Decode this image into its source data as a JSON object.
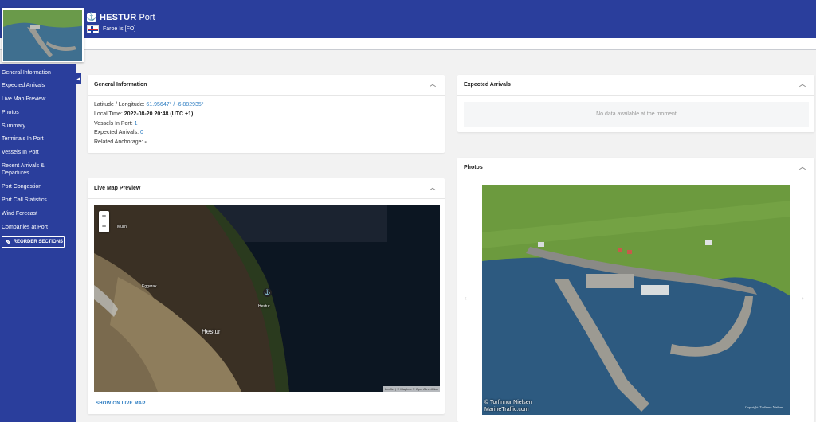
{
  "header": {
    "port_name": "HESTUR",
    "port_type": "Port",
    "country": "Faroe Is [FO]"
  },
  "sidebar": {
    "items": [
      {
        "label": "General Information"
      },
      {
        "label": "Expected Arrivals"
      },
      {
        "label": "Live Map Preview"
      },
      {
        "label": "Photos"
      },
      {
        "label": "Summary"
      },
      {
        "label": "Terminals In Port"
      },
      {
        "label": "Vessels In Port"
      },
      {
        "label": "Recent Arrivals & Departures"
      },
      {
        "label": "Port Congestion"
      },
      {
        "label": "Port Call Statistics"
      },
      {
        "label": "Wind Forecast"
      },
      {
        "label": "Companies at Port"
      }
    ],
    "reorder_label": "REORDER SECTIONS"
  },
  "general": {
    "title": "General Information",
    "latlon_label": "Latitude / Longitude:",
    "latlon_value": "61.95647° / -6.882935°",
    "localtime_label": "Local Time:",
    "localtime_value": "2022-08-20 20:48 (UTC +1)",
    "vessels_label": "Vessels In Port:",
    "vessels_value": "1",
    "expected_label": "Expected Arrivals:",
    "expected_value": "0",
    "anchorage_label": "Related Anchorage:",
    "anchorage_value": "-"
  },
  "expected": {
    "title": "Expected Arrivals",
    "nodata": "No data available at the moment"
  },
  "map": {
    "title": "Live Map Preview",
    "zoom_in": "+",
    "zoom_out": "−",
    "labels": {
      "mulin": "Mulin",
      "eggarak": "Eggarak",
      "hestur_port": "Hestur",
      "hestur_island": "Hestur"
    },
    "attribution": "Leaflet | © Mapbox © OpenStreetMap",
    "show_link": "SHOW ON LIVE MAP"
  },
  "photos": {
    "title": "Photos",
    "credit_line1": "© Torfinnur Nielsen",
    "credit_line2": "MarineTraffic.com",
    "copyright": "Copyright: Torfinnur Nielsen"
  },
  "colors": {
    "brand": "#2a3e9c",
    "link": "#2c7cc1",
    "background": "#f2f2f2"
  }
}
